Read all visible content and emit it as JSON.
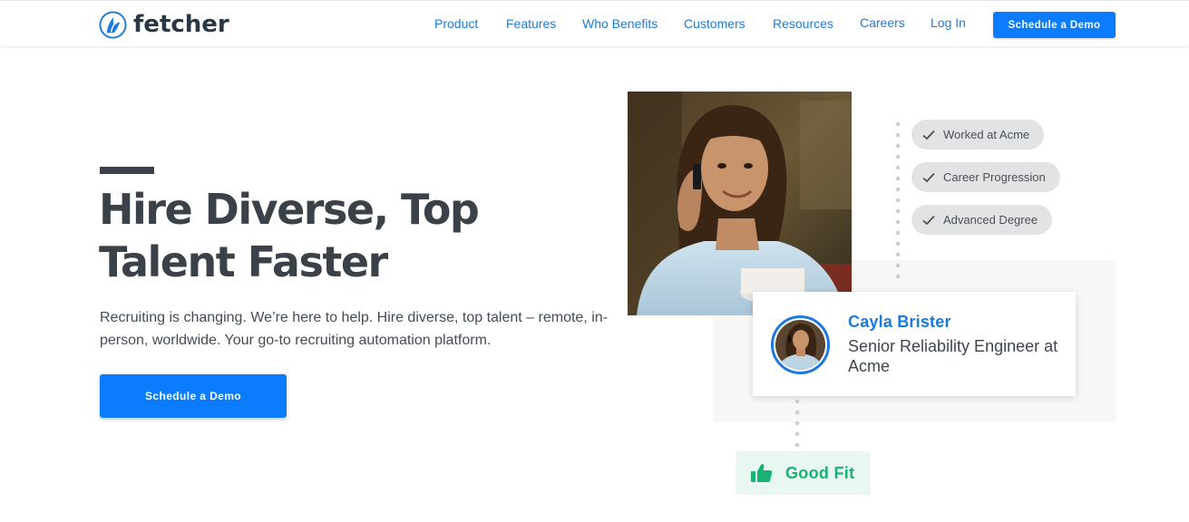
{
  "header": {
    "brand": "fetcher",
    "nav": [
      {
        "label": "Product",
        "id": "product"
      },
      {
        "label": "Features",
        "id": "features"
      },
      {
        "label": "Who Benefits",
        "id": "who-benefits"
      },
      {
        "label": "Customers",
        "id": "customers"
      },
      {
        "label": "Resources",
        "id": "resources"
      },
      {
        "label": "Careers",
        "id": "careers"
      },
      {
        "label": "Log In",
        "id": "log-in"
      }
    ],
    "cta_label": "Schedule a Demo"
  },
  "hero": {
    "title": "Hire Diverse, Top Talent Faster",
    "subtitle": "Recruiting is changing. We’re here to help. Hire diverse, top talent – remote, in-person, worldwide. Your go-to recruiting automation platform.",
    "cta_label": "Schedule a Demo"
  },
  "visual": {
    "tags": [
      "Worked at Acme",
      "Career Progression",
      "Advanced Degree"
    ],
    "candidate": {
      "name": "Cayla Brister",
      "title": "Senior Reliability Engineer at Acme"
    },
    "fit_label": "Good Fit"
  },
  "colors": {
    "brand_blue": "#0b7bff",
    "link_blue": "#1e7bd9",
    "heading": "#3a4149",
    "fit_green": "#18b274",
    "fit_bg": "#e8f7f1"
  },
  "icons": {
    "logo": "fetcher-logo-icon",
    "tag_check": "check-icon",
    "fit": "thumbs-up-icon"
  }
}
